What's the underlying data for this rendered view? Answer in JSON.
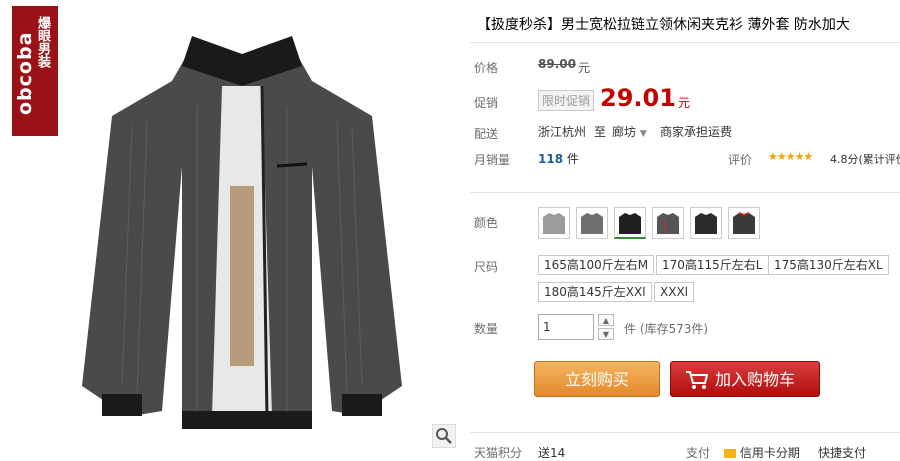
{
  "brand": {
    "logo_text": "obcoba",
    "chinese": "爆眼男装",
    "color": "#9b1216"
  },
  "product": {
    "title": "【扱度秒杀】男士宽松拉链立领休闲夹克衫 薄外套 防水加大"
  },
  "price": {
    "label": "价格",
    "original": "89.00",
    "currency": "元"
  },
  "promo": {
    "label": "促销",
    "tag": "限时促销",
    "price": "29.01",
    "currency": "元"
  },
  "shipping": {
    "label": "配送",
    "from": "浙江杭州",
    "to_prefix": "至",
    "to": "廊坊",
    "note": "商家承担运费"
  },
  "sales": {
    "label": "月销量",
    "count": "118",
    "unit": "件"
  },
  "rating": {
    "label": "评价",
    "stars": "★★★★★",
    "score": "4.8分(累计评价"
  },
  "colors": {
    "label": "颜色",
    "swatches": [
      "light-gray-jacket",
      "gray-jacket",
      "black-jacket-selected",
      "striped-jacket",
      "dark-jacket",
      "red-lined-jacket"
    ]
  },
  "sizes": {
    "label": "尺码",
    "options": [
      "165高100斤左右M",
      "170高115斤左右L",
      "175高130斤左右XL",
      "180高145斤左XXl",
      "XXXl"
    ]
  },
  "quantity": {
    "label": "数量",
    "value": "1",
    "stock": "件 (库存573件)"
  },
  "buttons": {
    "buy_now": "立刻购买",
    "add_to_cart": "加入购物车"
  },
  "bottom": {
    "points_label": "天猫积分",
    "points_text": "送14",
    "pay_label": "支付",
    "pay_credit": "信用卡分期",
    "pay_fast": "快捷支付"
  }
}
